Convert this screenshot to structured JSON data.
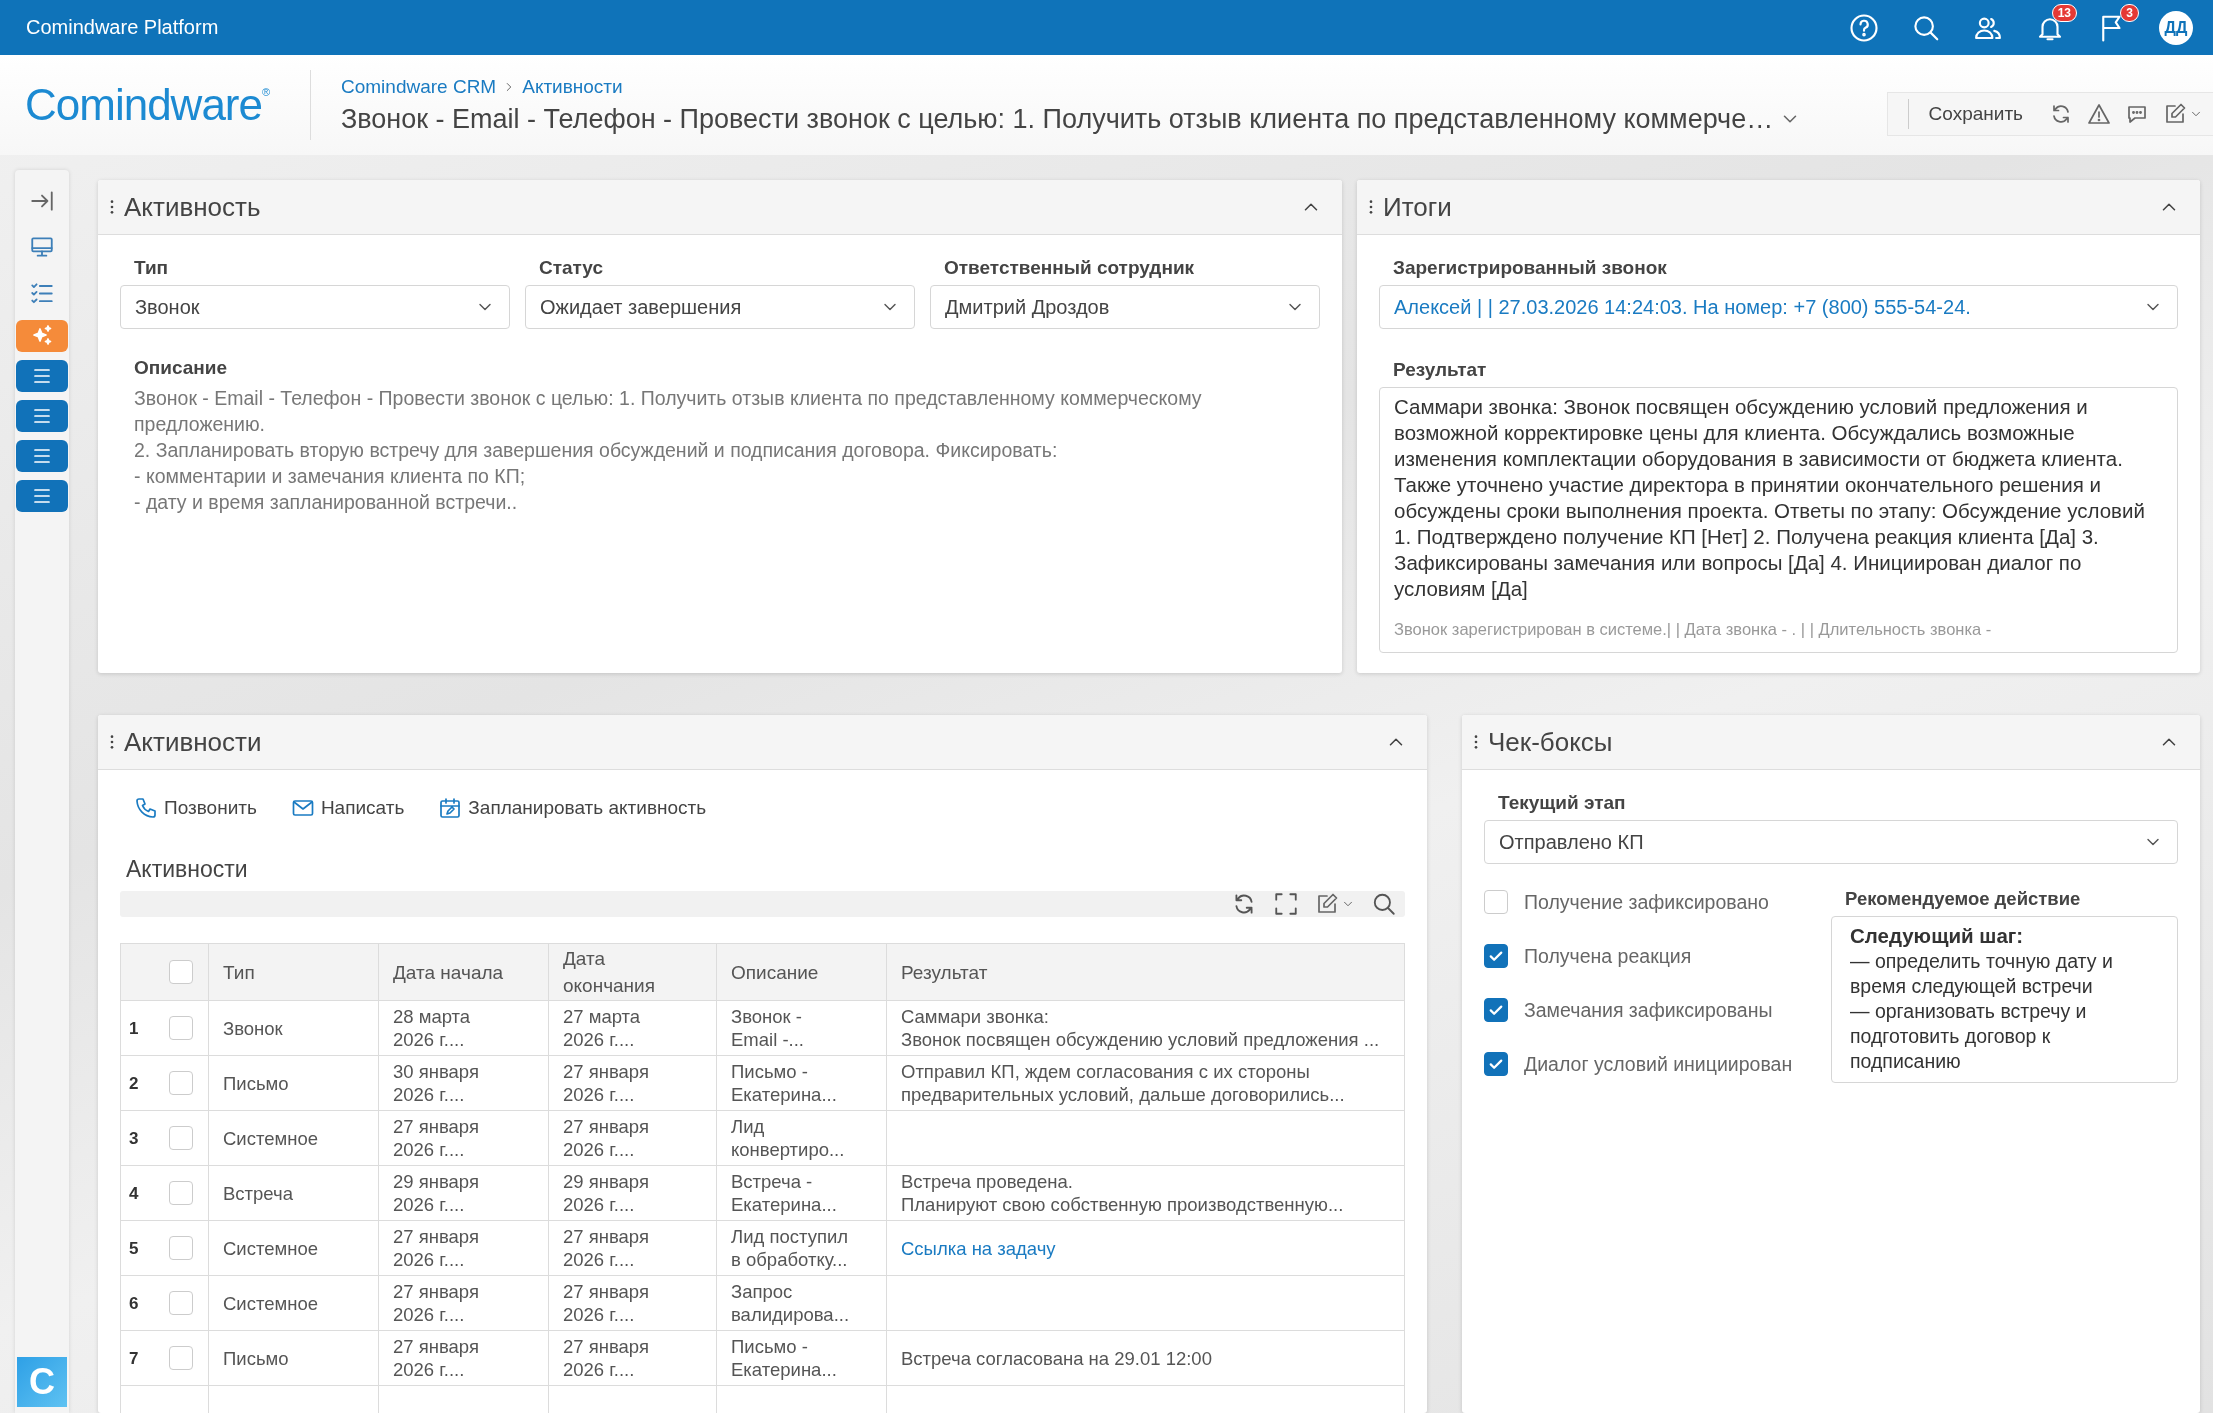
{
  "topbar": {
    "title": "Comindware Platform",
    "notifications_badge": "13",
    "messages_badge": "3",
    "avatar": "ДД"
  },
  "header": {
    "logo": "Comindware",
    "logo_mark": "®",
    "breadcrumb": [
      "Comindware CRM",
      "Активности"
    ],
    "title": "Звонок - Email - Телефон - Провести звонок с целью: 1. Получить отзыв клиента по представленному коммерче…",
    "save_button": "Сохранить"
  },
  "sidebar": {
    "tools": [
      {
        "kind": "collapse"
      },
      {
        "kind": "monitor"
      },
      {
        "kind": "checklist"
      }
    ],
    "tiles": [
      {
        "kind": "sparkle",
        "color": "#f58b3a"
      },
      {
        "kind": "list",
        "color": "#1172b9"
      },
      {
        "kind": "list",
        "color": "#1172b9"
      },
      {
        "kind": "list",
        "color": "#1172b9"
      },
      {
        "kind": "list",
        "color": "#1172b9"
      }
    ],
    "app_logo": "C"
  },
  "activity_panel": {
    "title": "Активность",
    "fields": [
      {
        "label": "Тип",
        "value": "Звонок"
      },
      {
        "label": "Статус",
        "value": "Ожидает завершения"
      },
      {
        "label": "Ответственный сотрудник",
        "value": "Дмитрий Дроздов"
      }
    ],
    "description_label": "Описание",
    "description": "Звонок - Email - Телефон - Провести звонок с целью: 1. Получить отзыв клиента по представленному коммерческому предложению.\n2. Запланировать вторую встречу для завершения обсуждений и подписания договора. Фиксировать:\n- комментарии и замечания клиента по КП;\n- дату и время запланированной встречи.."
  },
  "results_panel": {
    "title": "Итоги",
    "call_label": "Зарегистрированный звонок",
    "call_value": "Алексей | | 27.03.2026 14:24:03. На номер: +7 (800) 555-54-24.",
    "result_label": "Результат",
    "result": "Саммари звонка: Звонок посвящен обсуждению условий предложения и возможной корректировке цены для клиента. Обсуждались возможные изменения комплектации оборудования в зависимости от бюджета клиента. Также уточнено участие директора в принятии окончательного решения и обсуждены сроки выполнения проекта. Ответы по этапу: Обсуждение условий 1. Подтверждено получение КП [Нет] 2. Получена реакция клиента [Да] 3. Зафиксированы замечания или вопросы [Да] 4. Инициирован диалог по условиям [Да]",
    "result_note": "Звонок зарегистрирован в системе.| | Дата звонка - . | | Длительность звонка -"
  },
  "activities_panel": {
    "title": "Активности",
    "actions": [
      {
        "kind": "phone",
        "label": "Позвонить"
      },
      {
        "kind": "mail",
        "label": "Написать"
      },
      {
        "kind": "calendar",
        "label": "Запланировать активность"
      }
    ],
    "grid_title": "Активности",
    "columns": [
      "Тип",
      "Дата начала",
      "Дата окончания",
      "Описание",
      "Результат"
    ],
    "header_checked": false,
    "rows": [
      {
        "number": "1",
        "checked": false,
        "type": "Звонок",
        "start": "28 марта\n2026 г....",
        "end": "27 марта\n2026 г....",
        "description": "Звонок -\nEmail -...",
        "result": "Саммари звонка:\nЗвонок посвящен обсуждению условий предложения ...",
        "result_link": false
      },
      {
        "number": "2",
        "checked": false,
        "type": "Письмо",
        "start": "30 января\n2026 г....",
        "end": "27 января\n2026 г....",
        "description": "Письмо -\nЕкатерина...",
        "result": "Отправил КП, ждем согласования с их стороны\nпредварительных условий, дальше договорились...",
        "result_link": false
      },
      {
        "number": "3",
        "checked": false,
        "type": "Системное",
        "start": "27 января\n2026 г....",
        "end": "27 января\n2026 г....",
        "description": "Лид\nконвертиро..."
      },
      {
        "number": "4",
        "checked": false,
        "type": "Встреча",
        "start": "29 января\n2026 г....",
        "end": "29 января\n2026 г....",
        "description": "Встреча -\nЕкатерина...",
        "result": "Встреча проведена.\nПланируют свою собственную производственную...",
        "result_link": false
      },
      {
        "number": "5",
        "checked": false,
        "type": "Системное",
        "start": "27 января\n2026 г....",
        "end": "27 января\n2026 г....",
        "description": "Лид поступил\nв обработку...",
        "result": "Ссылка на задачу",
        "result_link": true
      },
      {
        "number": "6",
        "checked": false,
        "type": "Системное",
        "start": "27 января\n2026 г....",
        "end": "27 января\n2026 г....",
        "description": "Запрос\nвалидирова..."
      },
      {
        "number": "7",
        "checked": false,
        "type": "Письмо",
        "start": "27 января\n2026 г....",
        "end": "27 января\n2026 г....",
        "description": "Письмо -\nЕкатерина...",
        "result": "Встреча согласована на 29.01 12:00",
        "result_link": false
      }
    ]
  },
  "checkboxes_panel": {
    "title": "Чек-боксы",
    "stage_label": "Текущий этап",
    "stage_value": "Отправлено КП",
    "checkboxes": [
      {
        "label": "Получение зафиксировано",
        "checked": false
      },
      {
        "label": "Получена реакция",
        "checked": true
      },
      {
        "label": "Замечания зафиксированы",
        "checked": true
      },
      {
        "label": "Диалог условий инициирован",
        "checked": true
      }
    ],
    "recommendation_label": "Рекомендуемое действие",
    "recommendation": "**Следующий шаг:**\n— определить точную дату и время следующей встречи\n— организовать встречу и подготовить договор к подписанию"
  }
}
